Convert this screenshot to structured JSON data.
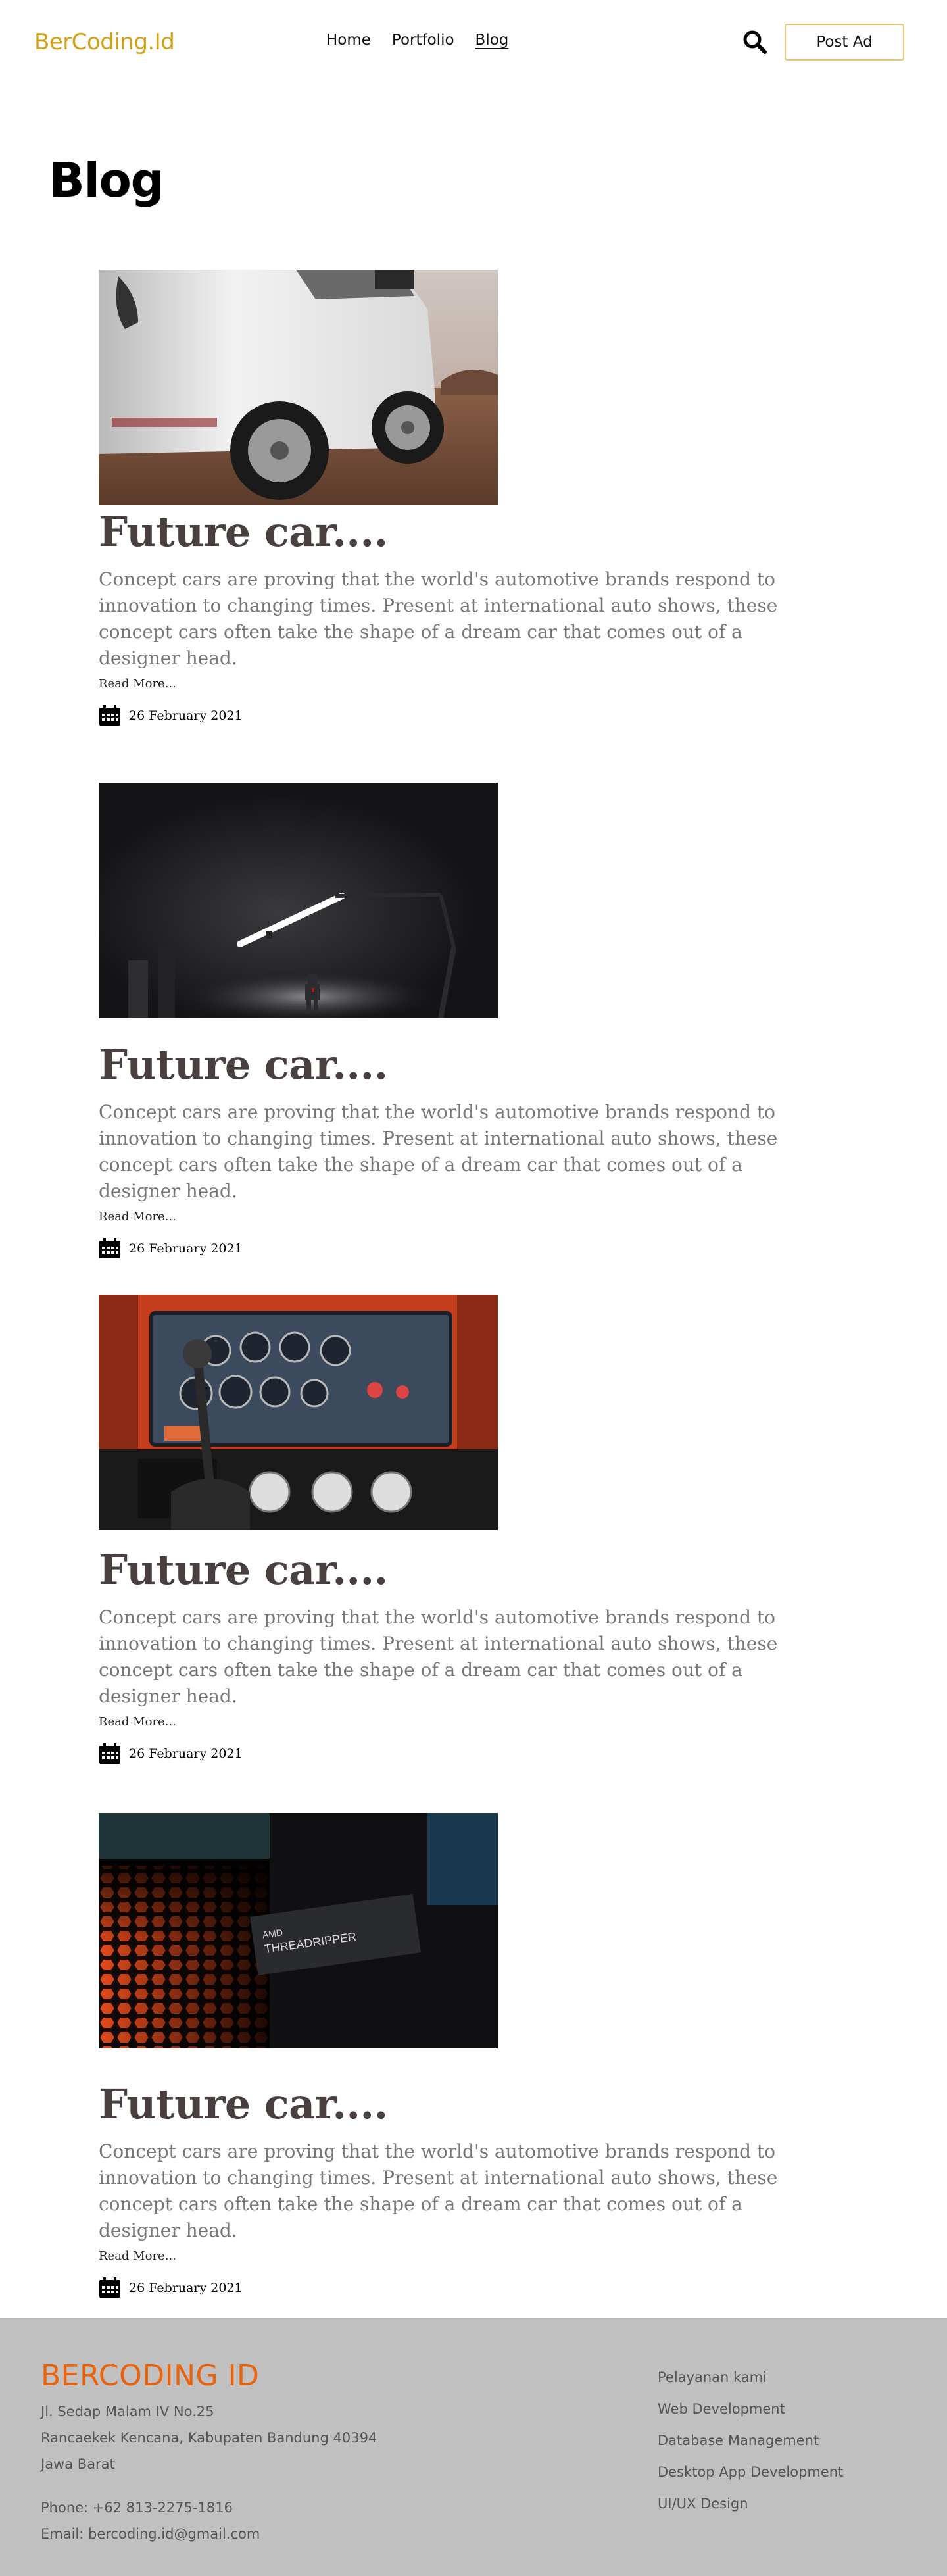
{
  "header": {
    "logo": "BerCoding.Id",
    "nav": [
      "Home",
      "Portfolio",
      "Blog"
    ],
    "active_nav": "Blog",
    "post_ad_label": "Post Ad"
  },
  "page": {
    "title": "Blog"
  },
  "posts": [
    {
      "title": "Future car....",
      "excerpt": "Concept cars are proving that the world's automotive brands respond to innovation to changing times. Present at international auto shows, these concept cars often take the shape of a dream car that comes out of a designer head.",
      "read_more": "Read More...",
      "date": "26 February 2021",
      "image": "white-car-photo"
    },
    {
      "title": "Future car....",
      "excerpt": "Concept cars are proving that the world's automotive brands respond to innovation to changing times. Present at international auto shows, these concept cars often take the shape of a dream car that comes out of a designer head.",
      "read_more": "Read More...",
      "date": "26 February 2021",
      "image": "desk-lamp-robot-photo"
    },
    {
      "title": "Future car....",
      "excerpt": "Concept cars are proving that the world's automotive brands respond to innovation to changing times. Present at international auto shows, these concept cars often take the shape of a dream car that comes out of a designer head.",
      "read_more": "Read More...",
      "date": "26 February 2021",
      "image": "vintage-dashboard-gauges-photo"
    },
    {
      "title": "Future car....",
      "excerpt": "Concept cars are proving that the world's automotive brands respond to innovation to changing times. Present at international auto shows, these concept cars often take the shape of a dream car that comes out of a designer head.",
      "read_more": "Read More...",
      "date": "26 February 2021",
      "image": "amd-threadripper-photo",
      "image_text_1": "AMD",
      "image_text_2": "THREADRIPPER"
    }
  ],
  "footer": {
    "brand": "BERCODING ID",
    "address": [
      "Jl. Sedap Malam IV No.25",
      "Rancaekek Kencana, Kabupaten Bandung 40394",
      "Jawa Barat"
    ],
    "phone": "Phone: +62 813-2275-1816",
    "email": "Email: bercoding.id@gmail.com",
    "services": [
      "Pelayanan kami",
      "Web Development",
      "Database Management",
      "Desktop App Development",
      "UI/UX Design"
    ]
  },
  "colors": {
    "logo": "#d4a017",
    "post_ad_border": "#e8c773",
    "post_title": "#4a3f3f",
    "excerpt": "#777777",
    "footer_bg": "#c0c0c0",
    "footer_brand": "#e8630c"
  },
  "icons": [
    "search-icon",
    "calendar-icon"
  ]
}
